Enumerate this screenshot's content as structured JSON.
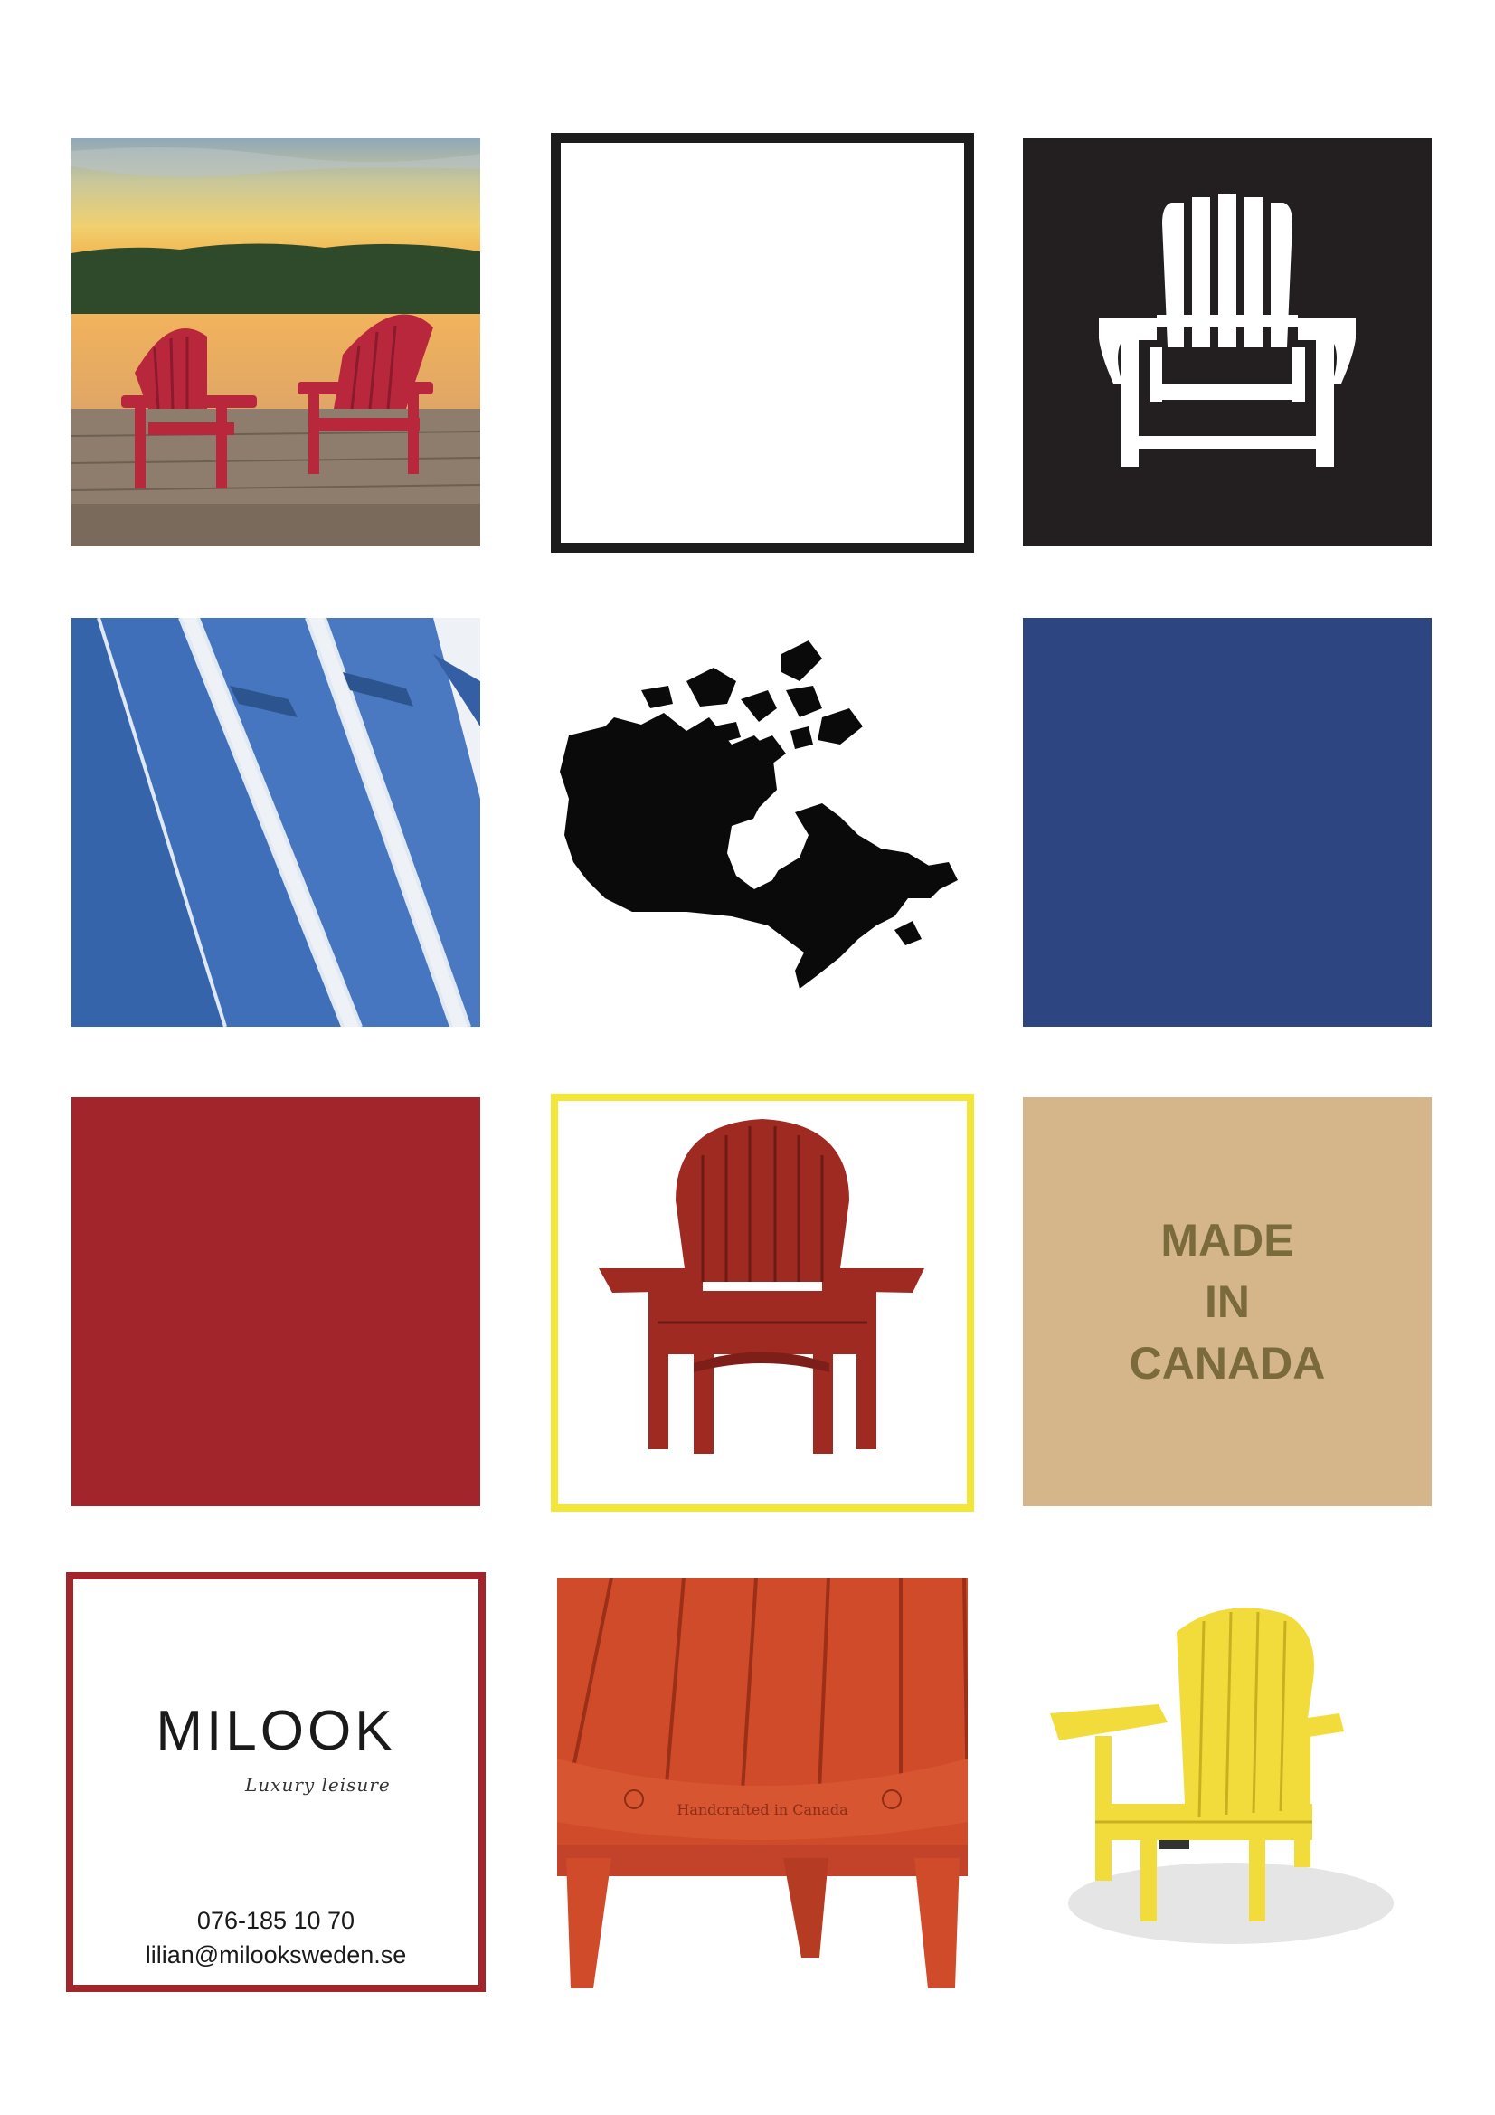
{
  "made_in_canada": {
    "line1": "MADE",
    "line2": "IN",
    "line3": "CANADA"
  },
  "brand": {
    "name": "MILOOK",
    "tagline": "Luxury leisure",
    "phone": "076-185 10 70",
    "email": "lilian@milooksweden.se"
  },
  "handcrafted_text": "Handcrafted in Canada",
  "colors": {
    "navy": "#2d4581",
    "red": "#a1252b",
    "tan": "#d4b68a",
    "yellow_frame": "#f4e637",
    "black": "#231f20"
  },
  "icons": {
    "chair_silhouette": "adirondack-chair-icon",
    "map": "canada-map-icon"
  }
}
